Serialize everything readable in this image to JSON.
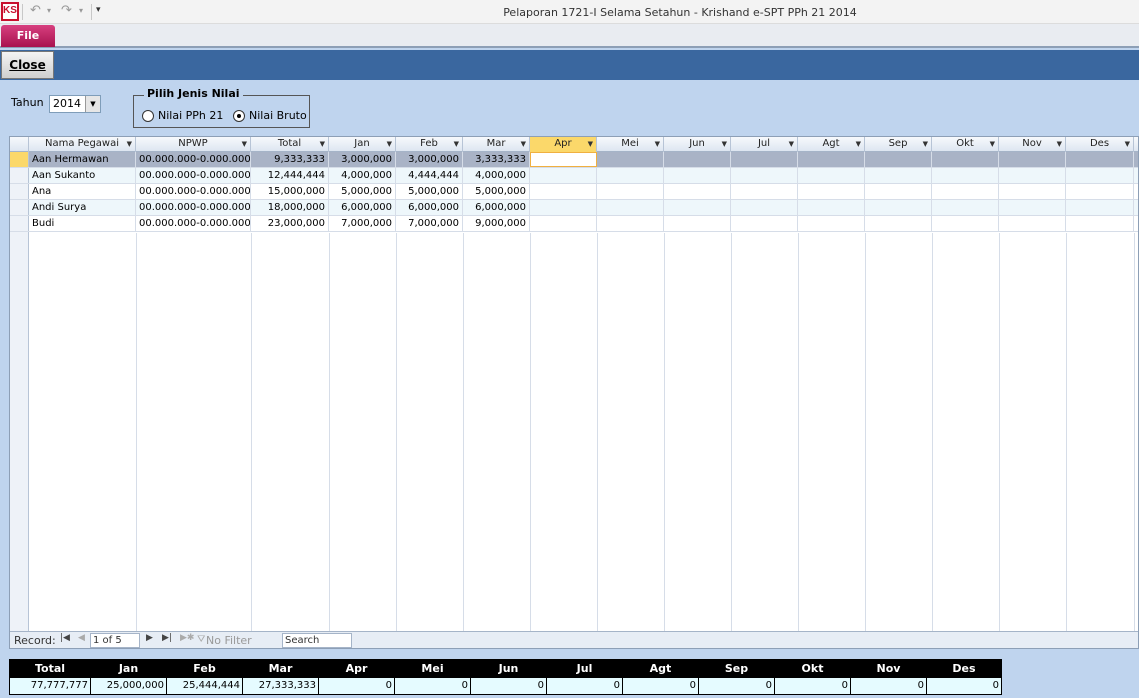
{
  "window": {
    "app_logo": "KS",
    "title": "Pelaporan 1721-I Selama Setahun  -  Krishand e-SPT PPh 21 2014",
    "file_tab": "File"
  },
  "toolbar": {
    "close_label": "Close"
  },
  "filter": {
    "tahun_label": "Tahun",
    "year": "2014",
    "group_label": "Pilih Jenis Nilai",
    "options": [
      "Nilai PPh 21",
      "Nilai Bruto"
    ],
    "selected": "Nilai Bruto"
  },
  "grid": {
    "columns": [
      "Nama Pegawai",
      "NPWP",
      "Total",
      "Jan",
      "Feb",
      "Mar",
      "Apr",
      "Mei",
      "Jun",
      "Jul",
      "Agt",
      "Sep",
      "Okt",
      "Nov",
      "Des"
    ],
    "rows": [
      [
        "Aan Hermawan",
        "00.000.000-0.000.000",
        "9,333,333",
        "3,000,000",
        "3,000,000",
        "3,333,333"
      ],
      [
        "Aan Sukanto",
        "00.000.000-0.000.000",
        "12,444,444",
        "4,000,000",
        "4,444,444",
        "4,000,000"
      ],
      [
        "Ana",
        "00.000.000-0.000.000",
        "15,000,000",
        "5,000,000",
        "5,000,000",
        "5,000,000"
      ],
      [
        "Andi Surya",
        "00.000.000-0.000.000",
        "18,000,000",
        "6,000,000",
        "6,000,000",
        "6,000,000"
      ],
      [
        "Budi",
        "00.000.000-0.000.000",
        "23,000,000",
        "7,000,000",
        "7,000,000",
        "9,000,000"
      ]
    ]
  },
  "navigator": {
    "record_label": "Record:",
    "position": "1 of 5",
    "filter_label": "No Filter",
    "search_label": "Search"
  },
  "totals": {
    "headers": [
      "Total",
      "Jan",
      "Feb",
      "Mar",
      "Apr",
      "Mei",
      "Jun",
      "Jul",
      "Agt",
      "Sep",
      "Okt",
      "Nov",
      "Des"
    ],
    "values": [
      "77,777,777",
      "25,000,000",
      "25,444,444",
      "27,333,333",
      "0",
      "0",
      "0",
      "0",
      "0",
      "0",
      "0",
      "0",
      "0"
    ]
  },
  "colors": {
    "accent_bar": "#3a679f",
    "file_tab": "#c21a64",
    "background": "#bfd4ee"
  }
}
